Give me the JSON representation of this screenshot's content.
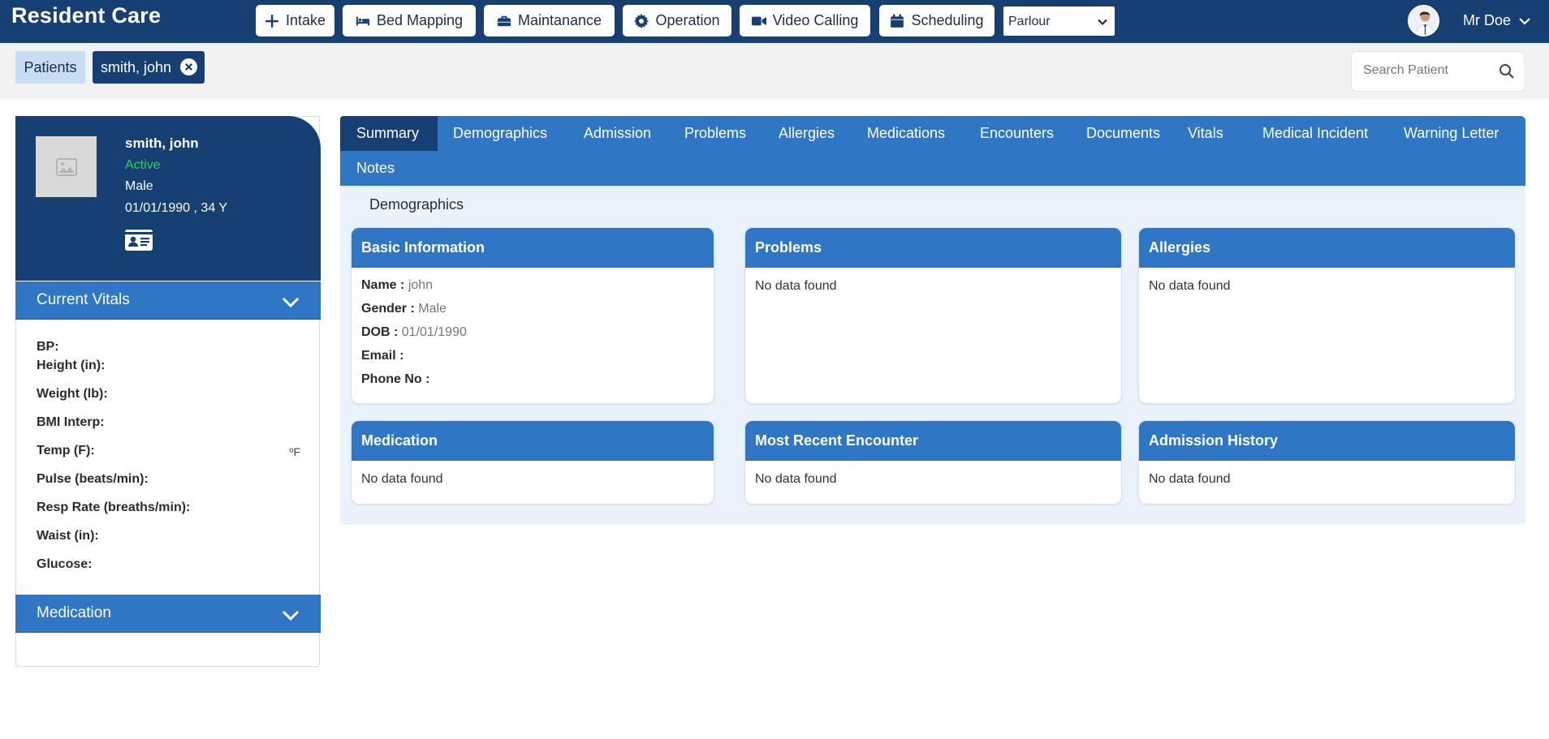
{
  "app": {
    "title": "Resident Care"
  },
  "nav": {
    "buttons": [
      {
        "label": "Intake",
        "icon": "plus-icon"
      },
      {
        "label": "Bed Mapping",
        "icon": "bed-icon"
      },
      {
        "label": "Maintanance",
        "icon": "toolbox-icon"
      },
      {
        "label": "Operation",
        "icon": "gear-icon"
      },
      {
        "label": "Video Calling",
        "icon": "video-camera-icon"
      },
      {
        "label": "Scheduling",
        "icon": "calendar-icon"
      }
    ],
    "location_select": {
      "selected": "Parlour"
    },
    "user": {
      "name": "Mr Doe"
    }
  },
  "patient_tabs": {
    "list_label": "Patients",
    "active_label": "smith, john"
  },
  "search": {
    "placeholder": "Search Patient"
  },
  "patient": {
    "name": "smith, john",
    "status": "Active",
    "gender": "Male",
    "dob_age": "01/01/1990 , 34 Y"
  },
  "sidebar": {
    "vitals_title": "Current Vitals",
    "vitals": [
      {
        "label": "BP:"
      },
      {
        "label": "Height (in):"
      },
      {
        "label": "Weight (lb):"
      },
      {
        "label": "BMI Interp:"
      },
      {
        "label": "Temp (F):",
        "unit": "ºF"
      },
      {
        "label": "Pulse (beats/min):"
      },
      {
        "label": "Resp Rate (breaths/min):"
      },
      {
        "label": "Waist (in):"
      },
      {
        "label": "Glucose:"
      }
    ],
    "medication_title": "Medication"
  },
  "tabs": [
    "Summary",
    "Demographics",
    "Admission",
    "Problems",
    "Allergies",
    "Medications",
    "Encounters",
    "Documents",
    "Vitals",
    "Medical Incident",
    "Warning Letter",
    "Notes"
  ],
  "summary": {
    "section_title": "Demographics",
    "basic_info": {
      "title": "Basic Information",
      "rows": [
        {
          "label": "Name :",
          "value": "john"
        },
        {
          "label": "Gender :",
          "value": "Male"
        },
        {
          "label": "DOB :",
          "value": "01/01/1990"
        },
        {
          "label": "Email :",
          "value": ""
        },
        {
          "label": "Phone No :",
          "value": ""
        }
      ]
    },
    "cards": {
      "problems": {
        "title": "Problems",
        "body": "No data found"
      },
      "allergies": {
        "title": "Allergies",
        "body": "No data found"
      },
      "medication": {
        "title": "Medication",
        "body": "No data found"
      },
      "encounter": {
        "title": "Most Recent Encounter",
        "body": "No data found"
      },
      "admission": {
        "title": "Admission History",
        "body": "No data found"
      }
    }
  },
  "colors": {
    "navy": "#163f73",
    "primary_blue": "#2f76c5",
    "active_green": "#2fd05a",
    "panel_bg": "#eaf2fc",
    "chip_blue": "#c6ddf4"
  }
}
